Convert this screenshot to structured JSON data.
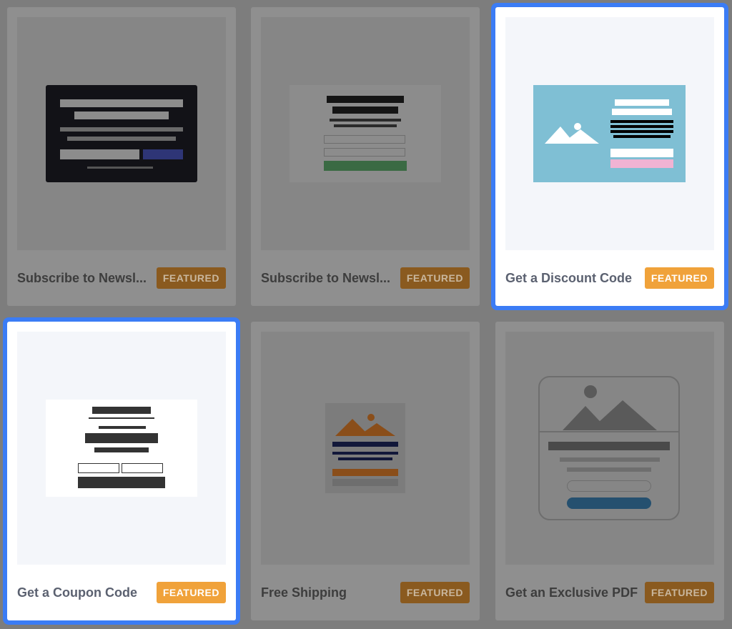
{
  "templates": [
    {
      "title": "Subscribe to Newsl...",
      "badge": "FEATURED",
      "selected": false
    },
    {
      "title": "Subscribe to Newsl...",
      "badge": "FEATURED",
      "selected": false
    },
    {
      "title": "Get a Discount Code",
      "badge": "FEATURED",
      "selected": true
    },
    {
      "title": "Get a Coupon Code",
      "badge": "FEATURED",
      "selected": true
    },
    {
      "title": "Free Shipping",
      "badge": "FEATURED",
      "selected": false
    },
    {
      "title": "Get an Exclusive PDF",
      "badge": "FEATURED",
      "selected": false
    }
  ],
  "colors": {
    "selection_outline": "#3b7cf5",
    "badge_active": "#f0a23a",
    "badge_dimmed": "#8a5a1f",
    "overlay": "#7d7d7d"
  }
}
